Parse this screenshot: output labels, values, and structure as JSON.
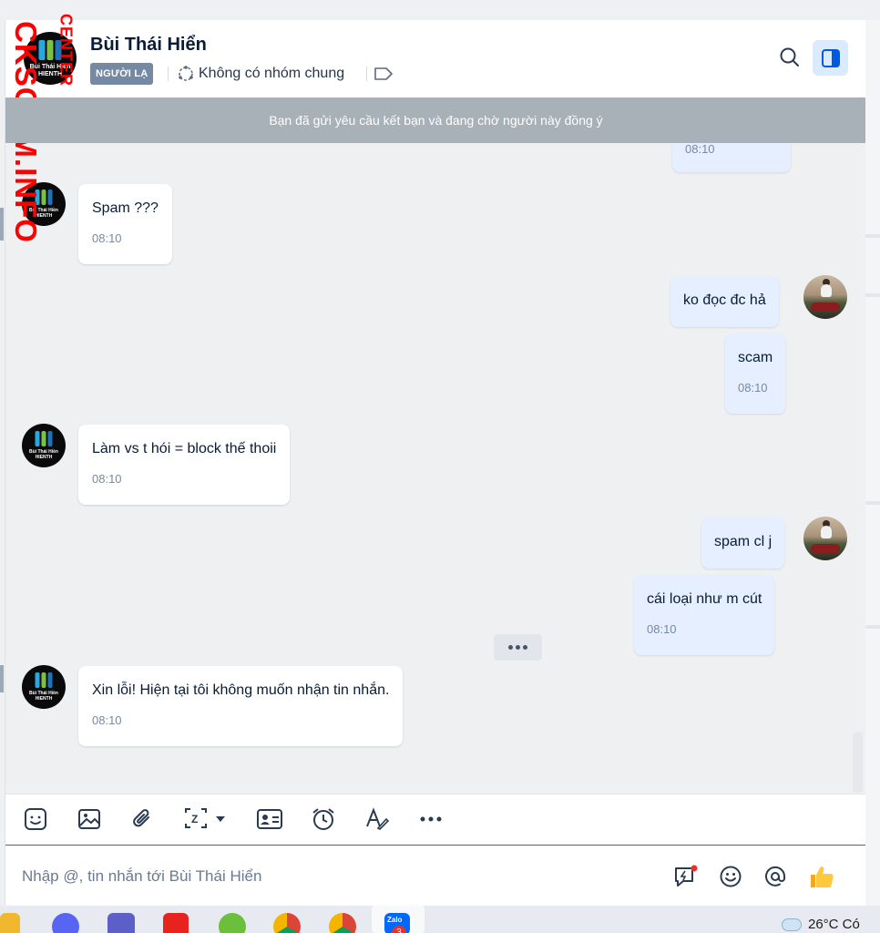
{
  "watermark": {
    "main": "CKSCAM.INFO",
    "sub": "CENTER"
  },
  "header": {
    "contact_name": "Bùi Thái Hiển",
    "badge": "NGƯỜI LẠ",
    "groups": "Không có nhóm chung",
    "avatar_caption_1": "Bùi Thái Hiền",
    "avatar_caption_2": "HIENTH"
  },
  "banner": "Bạn đã gửi yêu cầu kết bạn và đang chờ người này đồng ý",
  "messages": [
    {
      "dir": "out",
      "text": "",
      "time": "08:10"
    },
    {
      "dir": "in",
      "text": "Spam ???",
      "time": "08:10"
    },
    {
      "dir": "out",
      "text": "ko đọc đc hả",
      "time": ""
    },
    {
      "dir": "out",
      "text": "scam",
      "time": "08:10"
    },
    {
      "dir": "in",
      "text": "Làm vs t hói = block thế thoii",
      "time": "08:10"
    },
    {
      "dir": "out",
      "text": "spam cl j",
      "time": ""
    },
    {
      "dir": "out",
      "text": "cái loại như m cút",
      "time": "08:10"
    },
    {
      "dir": "in",
      "text": "Xin lỗi! Hiện tại tôi không muốn nhận tin nhắn.",
      "time": "08:10"
    }
  ],
  "composer": {
    "placeholder": "Nhập @, tin nhắn tới Bùi Thái Hiển"
  },
  "taskbar": {
    "weather": "26°C  Có",
    "zalo_badge": "3",
    "zalo_label": "Zalo"
  },
  "colors": {
    "accent": "#0068ff",
    "bubble_out": "#e5efff",
    "banner": "#a8b0b8",
    "badge": "#7589a3",
    "watermark": "#ff0000"
  },
  "icons": [
    "search-icon",
    "sidebar-toggle-icon",
    "tag-icon",
    "group-icon",
    "sticker-icon",
    "image-icon",
    "attachment-icon",
    "screenshot-icon",
    "contact-card-icon",
    "reminder-icon",
    "text-format-icon",
    "more-icon",
    "quick-message-icon",
    "emoji-icon",
    "mention-icon",
    "thumbs-up-icon"
  ]
}
